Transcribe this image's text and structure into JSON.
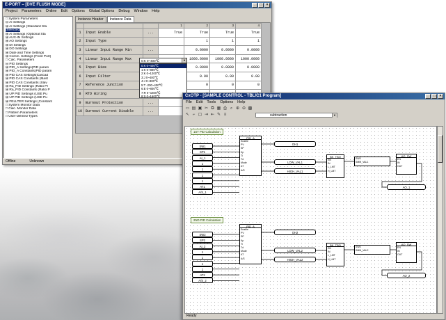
{
  "window1": {
    "title": "E-PORT – [DVE FLUSH MODE]",
    "menu": [
      "Project",
      "Parameters",
      "Online",
      "Edit",
      "Options",
      "Global Options",
      "Debug",
      "Window",
      "Help"
    ],
    "tree": [
      "□ System Parameters",
      "  ⊟ AI Settings",
      "    ⊞ AI Settings (Standard Sta",
      "      [Selected]",
      "    ⊞ AI Settings (Optional Sta",
      "    ⊞ AUX-IN Settings",
      "  ⊞ AO Settings",
      "  ⊞ DI Settings",
      "  ⊞ DO Settings",
      "  ⊞ Date and Time Settings",
      "  ⊞ Comm. Settings (Front Port)",
      "□ Calc. Parameters",
      "  ⊟ PID Settings",
      "    ⊞ PID_A Settings(PID param",
      "    ⊞ PID_A Constants(PID param",
      "    ⊞ PID CAS Settings(Cascad",
      "    ⊞ PID CAS Constants (Mast",
      "    ⊞ PID CAS Constants (Slav",
      "    ⊞ Ra_PID Settings (Ratio PI",
      "    ⊞ Ra_PID Constants (Ratio P",
      "    ⊞ UP PID Settings (USE Pu",
      "    ⊞ UP PID Settings (USE Pu",
      "  ⊞ FELLTER Settings (Constant",
      "□ System Monitor Data",
      "□ Calc. Monitor Data",
      "□ Pattern Parameters",
      "□ User-defined Types"
    ],
    "tabs": [
      "Instance Header",
      "Instance Data"
    ],
    "columns": [
      "",
      "",
      "",
      "1",
      "2",
      "3",
      "4"
    ],
    "rows": [
      {
        "n": "1",
        "name": "Input Enable",
        "btn": "...",
        "vals": [
          "True",
          "True",
          "True",
          "True"
        ]
      },
      {
        "n": "2",
        "name": "Input Type",
        "btn": "",
        "vals": [
          "",
          "1",
          "1",
          "1"
        ]
      },
      {
        "n": "3",
        "name": "Linear Input Range Min",
        "btn": "...",
        "vals": [
          "",
          "0.0000",
          "0.0000",
          "0.0000"
        ]
      },
      {
        "n": "4",
        "name": "Linear Input Range Max",
        "btn": "...",
        "vals": [
          "",
          "1000.0000",
          "1000.0000",
          "1000.0000"
        ]
      },
      {
        "n": "5",
        "name": "Input Bias",
        "btn": "...",
        "vals": [
          "",
          "0.0000",
          "0.0000",
          "0.0000"
        ]
      },
      {
        "n": "6",
        "name": "Input Filter",
        "btn": "...",
        "vals": [
          "",
          "0.00",
          "0.00",
          "0.00"
        ]
      },
      {
        "n": "7",
        "name": "Reference Junction",
        "btn": "...",
        "vals": [
          "",
          "0",
          "0",
          "0"
        ]
      },
      {
        "n": "8",
        "name": "RTD Wiring",
        "btn": "...",
        "vals": [
          "",
          "0",
          "0",
          "0"
        ]
      },
      {
        "n": "9",
        "name": "Burnout Protection",
        "btn": "...",
        "vals": [
          "",
          "1",
          "1",
          "1"
        ]
      },
      {
        "n": "10",
        "name": "Burnout Current Disable",
        "btn": "...",
        "vals": [
          "",
          "False",
          "False",
          "False"
        ]
      }
    ],
    "dropdown_value": "0:K 0~400℃",
    "dropdown_options": [
      "0:K 0~400℃",
      "1:K 0~800℃",
      "2:K 0~1200℃",
      "3:J 0~400℃",
      "4:J 0~800℃",
      "5:T -200~400℃",
      "6:E 0~800℃",
      "7:R 0~1600℃",
      "8:S 0~1600℃"
    ],
    "status": [
      "Offline",
      "Unknown"
    ]
  },
  "window2": {
    "title": "CxOTP - [SAMPLE CONTROL - TBL/C1 Program]",
    "menu": [
      "File",
      "Edit",
      "Tools",
      "Options",
      "Help"
    ],
    "toolbar_icons": [
      "new-icon",
      "open-icon",
      "save-icon",
      "cut-icon",
      "copy-icon",
      "paste-icon",
      "print-icon",
      "find-icon",
      "zoom-in-icon",
      "zoom-out-icon",
      "grid-icon"
    ],
    "combo_value": "subtraction",
    "comment_1": "1ST PID Calculation",
    "comment_2": "2ND PID Calculation",
    "inputs_1": [
      "SW1",
      "SP1",
      "AI_1",
      "1",
      "1",
      "1",
      "1",
      "AT1",
      "A/S_1"
    ],
    "inputs_2": [
      "SW2",
      "SP2",
      "AI_2",
      "1",
      "1",
      "1",
      "1",
      "AT2",
      "A/S_2"
    ],
    "pid_block": "PID_A",
    "pid_pins": [
      "Enable",
      "PV",
      "SP",
      "Kp",
      "Ti",
      "Td",
      "Mode",
      "AT",
      "A/S"
    ],
    "pid_out": [
      "MV",
      "A_OUT"
    ],
    "out_1": [
      "OH1",
      "LOW_VAL1",
      "HIGH_VAL1"
    ],
    "out_2": [
      "OH2",
      "LOW_VAL2",
      "HIGH_VAL2"
    ],
    "limit_block": "BK_TBO",
    "limit_pins": [
      "EN",
      "IN",
      "L_LMT",
      "H_LMT"
    ],
    "cmp_1": [
      "SW3",
      "SMM_VAL1"
    ],
    "cmp_2": [
      "SW4",
      "SMM_VAL2"
    ],
    "ao_block": "AO_SW",
    "ao_pins": [
      "EN",
      "IN",
      "OUT"
    ],
    "final_1": "AO_1",
    "final_2": "AO_2",
    "status": "Ready"
  }
}
